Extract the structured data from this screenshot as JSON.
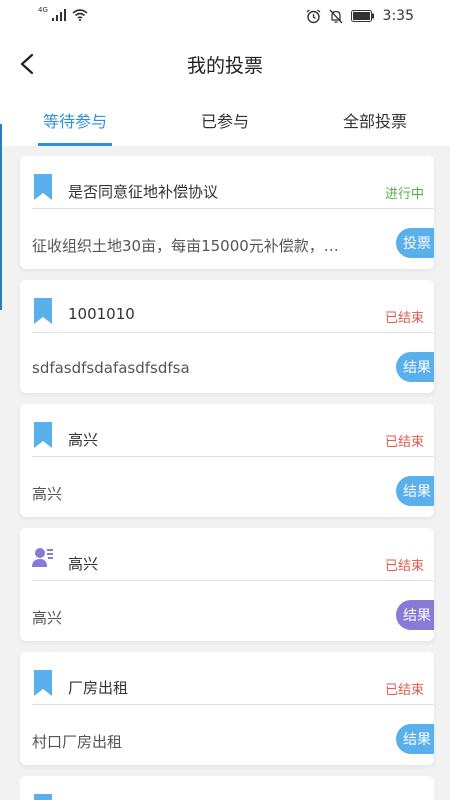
{
  "status_bar": {
    "network": "4G",
    "time": "3:35"
  },
  "header": {
    "title": "我的投票"
  },
  "tabs": [
    {
      "label": "等待参与",
      "active": true
    },
    {
      "label": "已参与",
      "active": false
    },
    {
      "label": "全部投票",
      "active": false
    }
  ],
  "colors": {
    "accent": "#2d8fe0",
    "ongoing": "#52b34a",
    "ended": "#e45a4c",
    "vote_button": "#5ab0ea",
    "result_button_alt": "#8a7ad8"
  },
  "cards": [
    {
      "icon": "bookmark-icon",
      "title": "是否同意征地补偿协议",
      "status": "进行中",
      "status_kind": "ongoing",
      "desc": "征收组织土地30亩，每亩15000元补偿款，…",
      "button": "投票",
      "button_kind": "vote"
    },
    {
      "icon": "bookmark-icon",
      "title": "1001010",
      "status": "已结束",
      "status_kind": "ended",
      "desc": "sdfasdfsdafasdfsdfsa",
      "button": "结果",
      "button_kind": "result"
    },
    {
      "icon": "bookmark-icon",
      "title": "高兴",
      "status": "已结束",
      "status_kind": "ended",
      "desc": "高兴",
      "button": "结果",
      "button_kind": "result"
    },
    {
      "icon": "person-list-icon",
      "title": "高兴",
      "status": "已结束",
      "status_kind": "ended",
      "desc": "高兴",
      "button": "结果",
      "button_kind": "result-alt"
    },
    {
      "icon": "bookmark-icon",
      "title": "厂房出租",
      "status": "已结束",
      "status_kind": "ended",
      "desc": "村口厂房出租",
      "button": "结果",
      "button_kind": "result"
    }
  ]
}
